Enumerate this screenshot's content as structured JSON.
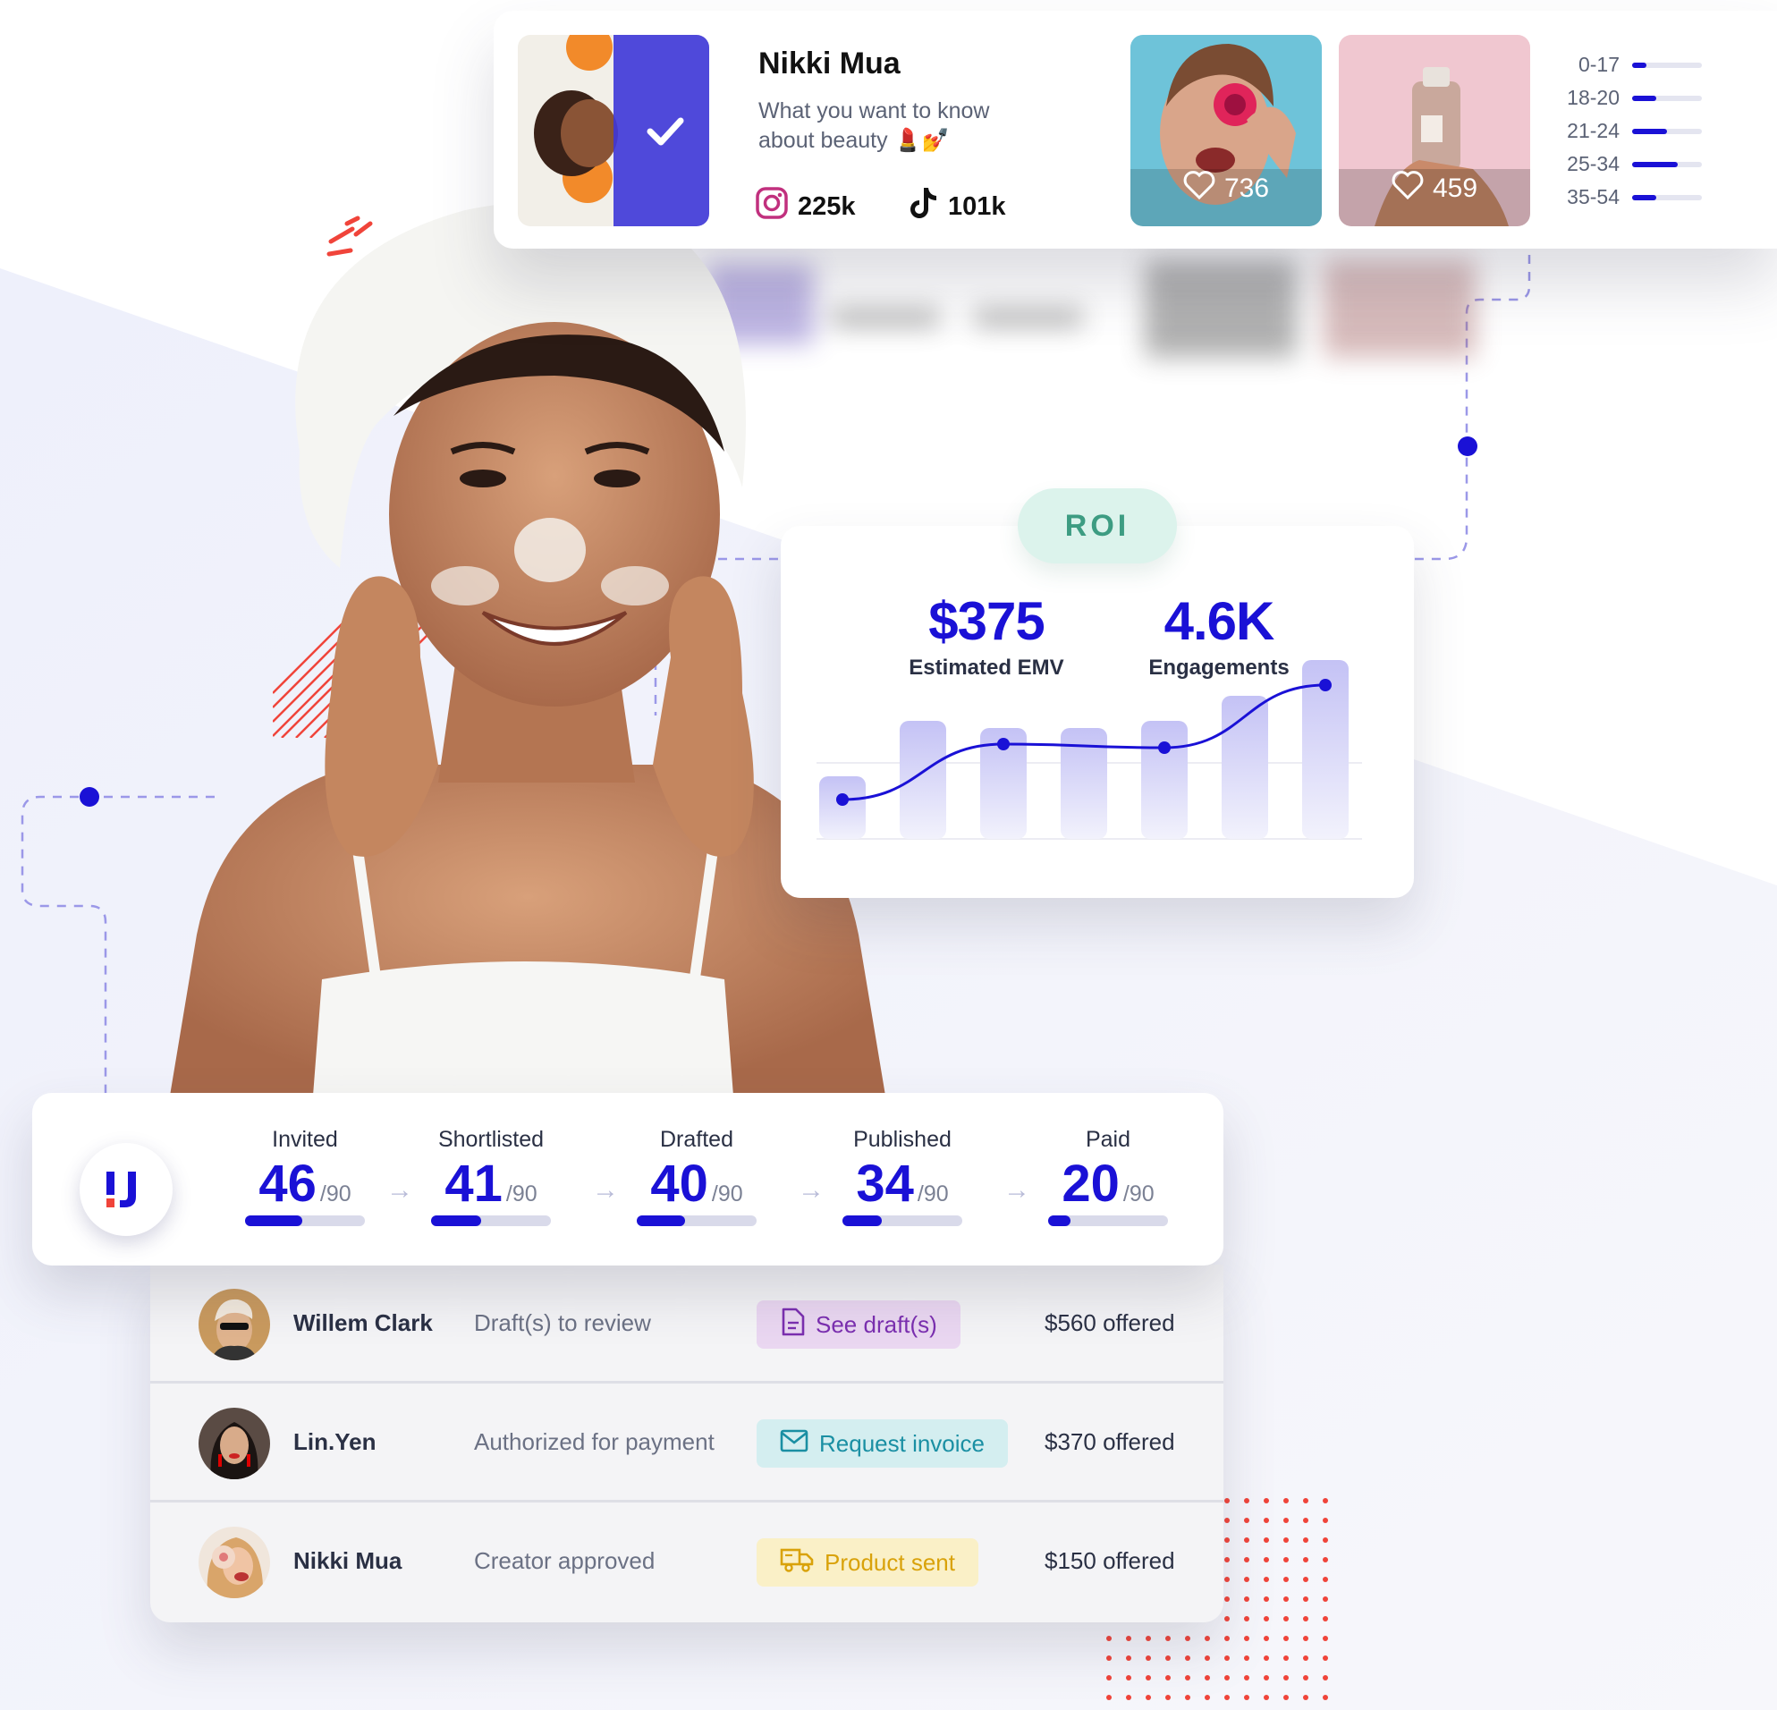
{
  "profile": {
    "name": "Nikki Mua",
    "bio": "What you want to know about beauty 💄💅",
    "instagram_followers": "225k",
    "tiktok_followers": "101k",
    "posts": [
      {
        "likes": "736"
      },
      {
        "likes": "459"
      }
    ],
    "age_groups": [
      {
        "label": "0-17",
        "level": 0.2
      },
      {
        "label": "18-20",
        "level": 0.35
      },
      {
        "label": "21-24",
        "level": 0.5
      },
      {
        "label": "25-34",
        "level": 0.65
      },
      {
        "label": "35-54",
        "level": 0.35
      }
    ]
  },
  "roi": {
    "label": "ROI",
    "emv_value": "$375",
    "emv_label": "Estimated EMV",
    "engagements_value": "4.6K",
    "engagements_label": "Engagements",
    "bar_levels": [
      0.35,
      0.66,
      0.62,
      0.62,
      0.66,
      0.8,
      1.0
    ],
    "line_levels": [
      0.22,
      null,
      0.53,
      null,
      0.51,
      null,
      0.86
    ]
  },
  "pipeline": {
    "stages": [
      {
        "label": "Invited",
        "count": "46",
        "total": "/90",
        "progress": 0.48
      },
      {
        "label": "Shortlisted",
        "count": "41",
        "total": "/90",
        "progress": 0.42
      },
      {
        "label": "Drafted",
        "count": "40",
        "total": "/90",
        "progress": 0.4
      },
      {
        "label": "Published",
        "count": "34",
        "total": "/90",
        "progress": 0.33
      },
      {
        "label": "Paid",
        "count": "20",
        "total": "/90",
        "progress": 0.19
      }
    ]
  },
  "creators": [
    {
      "name": "Willem Clark",
      "status": "Draft(s) to review",
      "action": "See draft(s)",
      "action_icon": "document-icon",
      "offer": "$560 offered",
      "color": "#7b2fb0",
      "bg": "#ead7f1"
    },
    {
      "name": "Lin.Yen",
      "status": "Authorized for payment",
      "action": "Request invoice",
      "action_icon": "mail-icon",
      "offer": "$370 offered",
      "color": "#1a8fa3",
      "bg": "#d4eef0"
    },
    {
      "name": "Nikki Mua",
      "status": "Creator approved",
      "action": "Product sent",
      "action_icon": "truck-icon",
      "offer": "$150 offered",
      "color": "#d9a20a",
      "bg": "#faf0c7"
    }
  ],
  "colors": {
    "accent": "#1a11d6",
    "roi_green": "#3d9c82",
    "deco_red": "#f0443a"
  }
}
